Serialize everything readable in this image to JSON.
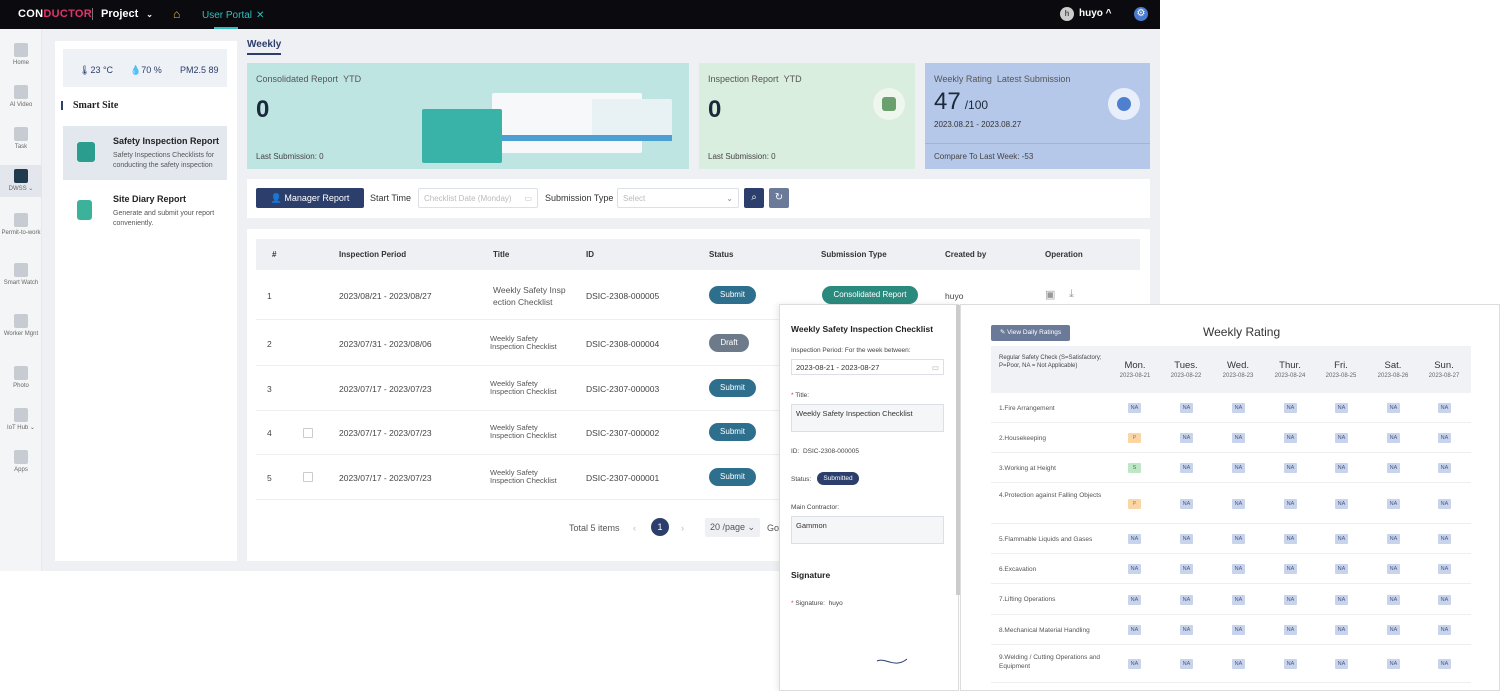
{
  "topbar": {
    "logo_pre": "CON",
    "logo_mid": "DUCTOR",
    "project": "Project",
    "tab_label": "User Portal",
    "user": "huyo",
    "avatar": "h"
  },
  "nav": [
    {
      "label": "Home",
      "icon": "home-icon"
    },
    {
      "label": "AI Video",
      "icon": "camera-icon"
    },
    {
      "label": "Task",
      "icon": "task-icon"
    },
    {
      "label": "DWSS ⌄",
      "icon": "dwss-icon"
    },
    {
      "label": "Permit-to-work",
      "icon": "permit-icon"
    },
    {
      "label": "Smart Watch",
      "icon": "watch-icon"
    },
    {
      "label": "Worker Mgnt",
      "icon": "worker-icon"
    },
    {
      "label": "Photo",
      "icon": "photo-icon"
    },
    {
      "label": "IoT Hub ⌄",
      "icon": "iot-icon"
    },
    {
      "label": "Apps",
      "icon": "apps-icon"
    }
  ],
  "weather": {
    "temp": "23 °C",
    "humidity": "70 %",
    "pm": "PM2.5 89"
  },
  "smart_site": "Smart Site",
  "modules": [
    {
      "title": "Safety Inspection Report",
      "desc": "Safety Inspections Checklists for conducting the safety inspection"
    },
    {
      "title": "Site Diary Report",
      "desc": "Generate and submit your report conveniently."
    }
  ],
  "tab_weekly": "Weekly",
  "kpis": {
    "consolidated": {
      "title": "Consolidated Report",
      "tag": "YTD",
      "value": "0",
      "foot": "Last Submission:  0"
    },
    "inspection": {
      "title": "Inspection Report",
      "tag": "YTD",
      "value": "0",
      "foot": "Last Submission:  0"
    },
    "rating": {
      "title": "Weekly Rating",
      "tag": "Latest Submission",
      "value": "47",
      "of": "/100",
      "range": "2023.08.21 - 2023.08.27",
      "compare": "Compare To Last Week:  -53"
    }
  },
  "filter": {
    "manager_btn": "Manager Report",
    "start_label": "Start Time",
    "start_placeholder": "Checklist Date (Monday)",
    "type_label": "Submission Type",
    "type_placeholder": "Select"
  },
  "table": {
    "headers": [
      "#",
      "Inspection Period",
      "Title",
      "ID",
      "Status",
      "Submission Type",
      "Created by",
      "Operation"
    ],
    "rows": [
      {
        "n": "1",
        "period": "2023/08/21 - 2023/08/27",
        "title1": "Weekly Safety Insp",
        "title2": "ection Checklist",
        "id": "DSIC-2308-000005",
        "status": "Submit",
        "type": "Consolidated Report",
        "by": "huyo"
      },
      {
        "n": "2",
        "period": "2023/07/31 - 2023/08/06",
        "title1": "Weekly Safety",
        "title2": "Inspection Checklist",
        "id": "DSIC-2308-000004",
        "status": "Draft"
      },
      {
        "n": "3",
        "period": "2023/07/17 - 2023/07/23",
        "title1": "Weekly Safety",
        "title2": "Inspection Checklist",
        "id": "DSIC-2307-000003",
        "status": "Submit"
      },
      {
        "n": "4",
        "period": "2023/07/17 - 2023/07/23",
        "title1": "Weekly Safety",
        "title2": "Inspection Checklist",
        "id": "DSIC-2307-000002",
        "status": "Submit"
      },
      {
        "n": "5",
        "period": "2023/07/17 - 2023/07/23",
        "title1": "Weekly Safety",
        "title2": "Inspection Checklist",
        "id": "DSIC-2307-000001",
        "status": "Submit"
      }
    ],
    "total": "Total 5 items",
    "page": "1",
    "per_page": "20 /page",
    "goto": "Go"
  },
  "detail": {
    "title": "Weekly Safety Inspection Checklist",
    "period_label": "Inspection Period: For the week between:",
    "period_value": "2023-08-21 - 2023-08-27",
    "title_label": "Title:",
    "title_value": "Weekly Safety Inspection Checklist",
    "id_label": "ID:",
    "id_value": "DSIC-2308-000005",
    "status_label": "Status:",
    "status_value": "Submitted",
    "contractor_label": "Main Contractor:",
    "contractor_value": "Gammon",
    "signature_heading": "Signature",
    "signature_label": "Signature:",
    "signature_value": "huyo"
  },
  "ratings": {
    "view_btn": "View Daily Ratings",
    "title": "Weekly Rating",
    "check_label": "Regular Safety Check (S=Satisfactory; P=Poor, NA = Not Applicable)",
    "days": [
      {
        "d": "Mon.",
        "date": "2023-08-21"
      },
      {
        "d": "Tues.",
        "date": "2023-08-22"
      },
      {
        "d": "Wed.",
        "date": "2023-08-23"
      },
      {
        "d": "Thur.",
        "date": "2023-08-24"
      },
      {
        "d": "Fri.",
        "date": "2023-08-25"
      },
      {
        "d": "Sat.",
        "date": "2023-08-26"
      },
      {
        "d": "Sun.",
        "date": "2023-08-27"
      }
    ],
    "items": [
      {
        "label": "1.Fire Arrangement",
        "vals": [
          "NA",
          "NA",
          "NA",
          "NA",
          "NA",
          "NA",
          "NA"
        ]
      },
      {
        "label": "2.Housekeeping",
        "vals": [
          "P",
          "NA",
          "NA",
          "NA",
          "NA",
          "NA",
          "NA"
        ]
      },
      {
        "label": "3.Working at Height",
        "vals": [
          "S",
          "NA",
          "NA",
          "NA",
          "NA",
          "NA",
          "NA"
        ]
      },
      {
        "label": "4.Protection against Falling Objects",
        "vals": [
          "P",
          "NA",
          "NA",
          "NA",
          "NA",
          "NA",
          "NA"
        ]
      },
      {
        "label": "5.Flammable Liquids and Gases",
        "vals": [
          "NA",
          "NA",
          "NA",
          "NA",
          "NA",
          "NA",
          "NA"
        ]
      },
      {
        "label": "6.Excavation",
        "vals": [
          "NA",
          "NA",
          "NA",
          "NA",
          "NA",
          "NA",
          "NA"
        ]
      },
      {
        "label": "7.Lifting Operations",
        "vals": [
          "NA",
          "NA",
          "NA",
          "NA",
          "NA",
          "NA",
          "NA"
        ]
      },
      {
        "label": "8.Mechanical Material Handling",
        "vals": [
          "NA",
          "NA",
          "NA",
          "NA",
          "NA",
          "NA",
          "NA"
        ]
      },
      {
        "label": "9.Welding / Cutting Operations and Equipment",
        "vals": [
          "NA",
          "NA",
          "NA",
          "NA",
          "NA",
          "NA",
          "NA"
        ]
      }
    ]
  },
  "colors": {
    "navy": "#2c3e6b",
    "teal": "#2fbfbf",
    "submit": "#2e6f8e",
    "draft": "#6d7a8a"
  }
}
